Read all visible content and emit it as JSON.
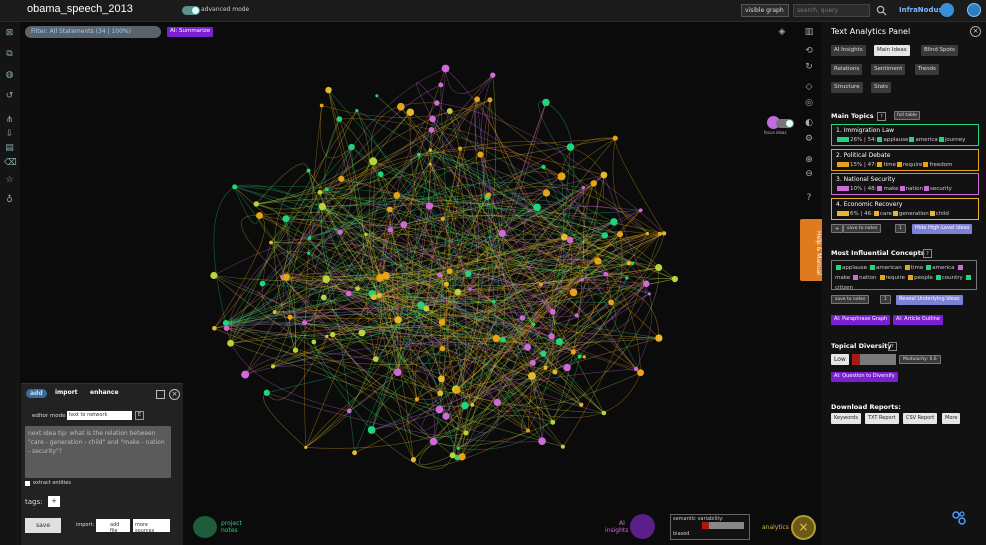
{
  "app": {
    "title": "obama_speech_2013",
    "advanced_mode": "advanced mode",
    "graph_select": "visible graph",
    "search_placeholder": "search, query",
    "user": "InfraNodus"
  },
  "filter": {
    "label": "Filter: All Statements (34 | 100%)",
    "ai_summarize": "AI: Summarize"
  },
  "graph_labels": {
    "focus_ideas": "focus ideas",
    "help_manual": "Help & Manual"
  },
  "panel": {
    "title": "Text Analytics Panel",
    "tabs": [
      "AI Insights",
      "Main Ideas",
      "Blind Spots",
      "Relations",
      "Sentiment",
      "Trends",
      "Structure",
      "Stats"
    ],
    "main_topics_label": "Main Topics",
    "qm": "?",
    "full_table": "full table",
    "topics": [
      {
        "title": "1. Immigration Law",
        "pct": "26%",
        "count": "54:",
        "words": [
          "applause",
          "america",
          "journey"
        ],
        "color": "#1fd67a"
      },
      {
        "title": "2. Political Debate",
        "pct": "15%",
        "count": "47:",
        "words": [
          "time",
          "require",
          "freedom"
        ],
        "color": "#e8a417"
      },
      {
        "title": "3. National Security",
        "pct": "10%",
        "count": "48:",
        "words": [
          "make",
          "nation",
          "security"
        ],
        "color": "#d06ad8"
      },
      {
        "title": "4. Economic Recovery",
        "pct": "6%",
        "count": "46:",
        "words": [
          "care",
          "generation",
          "child"
        ],
        "color": "#e5b82e"
      }
    ],
    "plus": "+",
    "save_notes": "save to notes",
    "one": "1",
    "hide_high": "Hide High-Level Ideas",
    "influential_label": "Most Influential Concepts",
    "concepts": [
      "applause",
      "american",
      "time",
      "america",
      "make",
      "nation",
      "require",
      "people",
      "country",
      "citizen"
    ],
    "reveal": "Reveal Underlying Ideas",
    "paraphrase": "AI: Paraphrase Graph",
    "article": "AI: Article Outline",
    "diversity_label": "Topical Diversity",
    "diversity_level": "Low",
    "modularity": "Modularity: 0.6",
    "question": "AI: Question to Diversify",
    "download_label": "Download Reports:",
    "downloads": [
      "Keywords",
      "TXT Report",
      "CSV Report",
      "More"
    ]
  },
  "editor": {
    "tabs": [
      "add",
      "import",
      "enhance"
    ],
    "mode_label": "editor mode",
    "mode_value": "text to network",
    "mode_icon": "E",
    "tip": "next idea tip: what is the relation between \"care - generation - child\" and \"make - nation - security\"?",
    "extract": "extract entities",
    "tags": "tags:",
    "tag_add": "+",
    "save": "save",
    "import_label": "import:",
    "add_file": "add file",
    "more_sources": "more sources"
  },
  "bottom": {
    "project_notes_1": "project",
    "project_notes_2": "notes",
    "ai_1": "AI",
    "ai_2": "insights",
    "sem_label": "semantic variability:",
    "sem_value": "biased",
    "analytics": "analytics"
  }
}
